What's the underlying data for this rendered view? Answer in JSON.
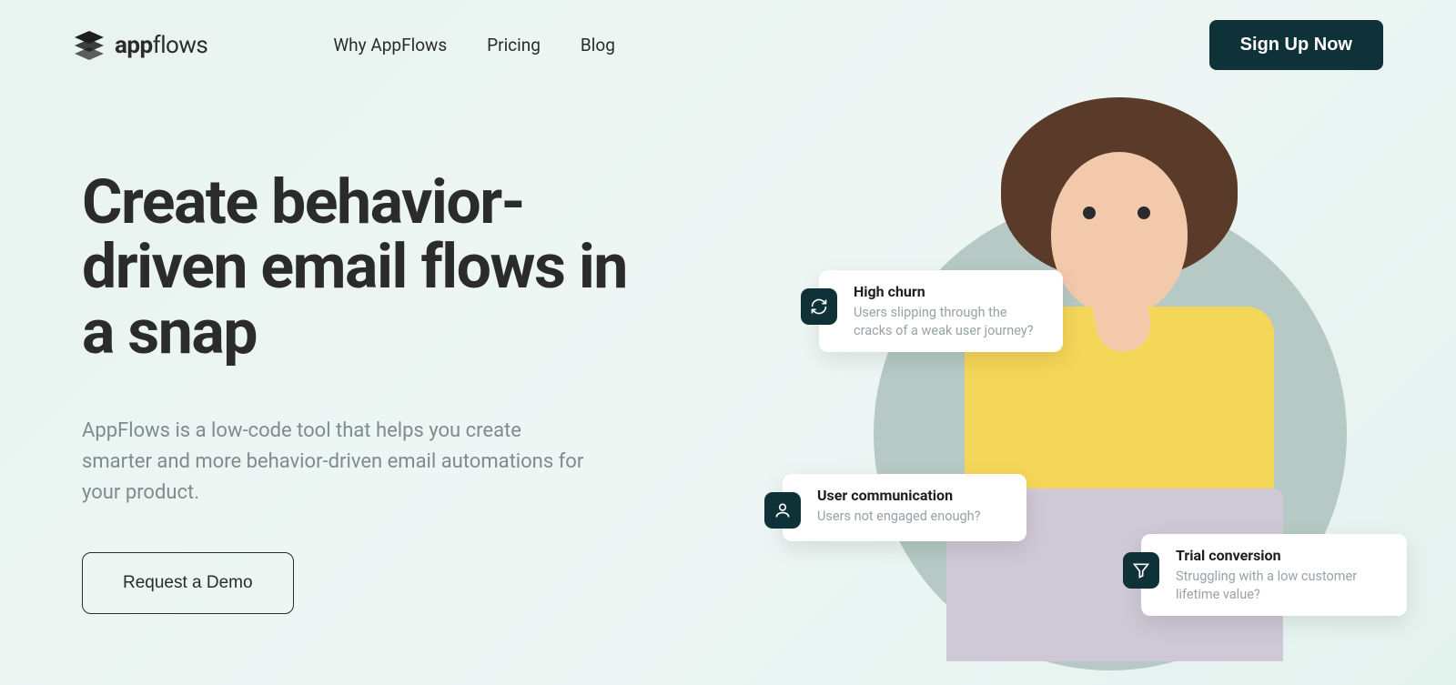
{
  "brand": {
    "bold": "app",
    "rest": "flows"
  },
  "nav": {
    "links": [
      "Why AppFlows",
      "Pricing",
      "Blog"
    ],
    "signup": "Sign Up Now"
  },
  "hero": {
    "title": "Create behavior-driven email flows in a snap",
    "subtitle": "AppFlows is a low-code tool that helps you create smarter and more behavior-driven email automations for your product.",
    "demo_button": "Request a Demo"
  },
  "cards": [
    {
      "title": "High churn",
      "desc": "Users slipping through the cracks of a weak user journey?"
    },
    {
      "title": "User communication",
      "desc": "Users not engaged enough?"
    },
    {
      "title": "Trial conversion",
      "desc": "Struggling with a low customer lifetime value?"
    }
  ]
}
